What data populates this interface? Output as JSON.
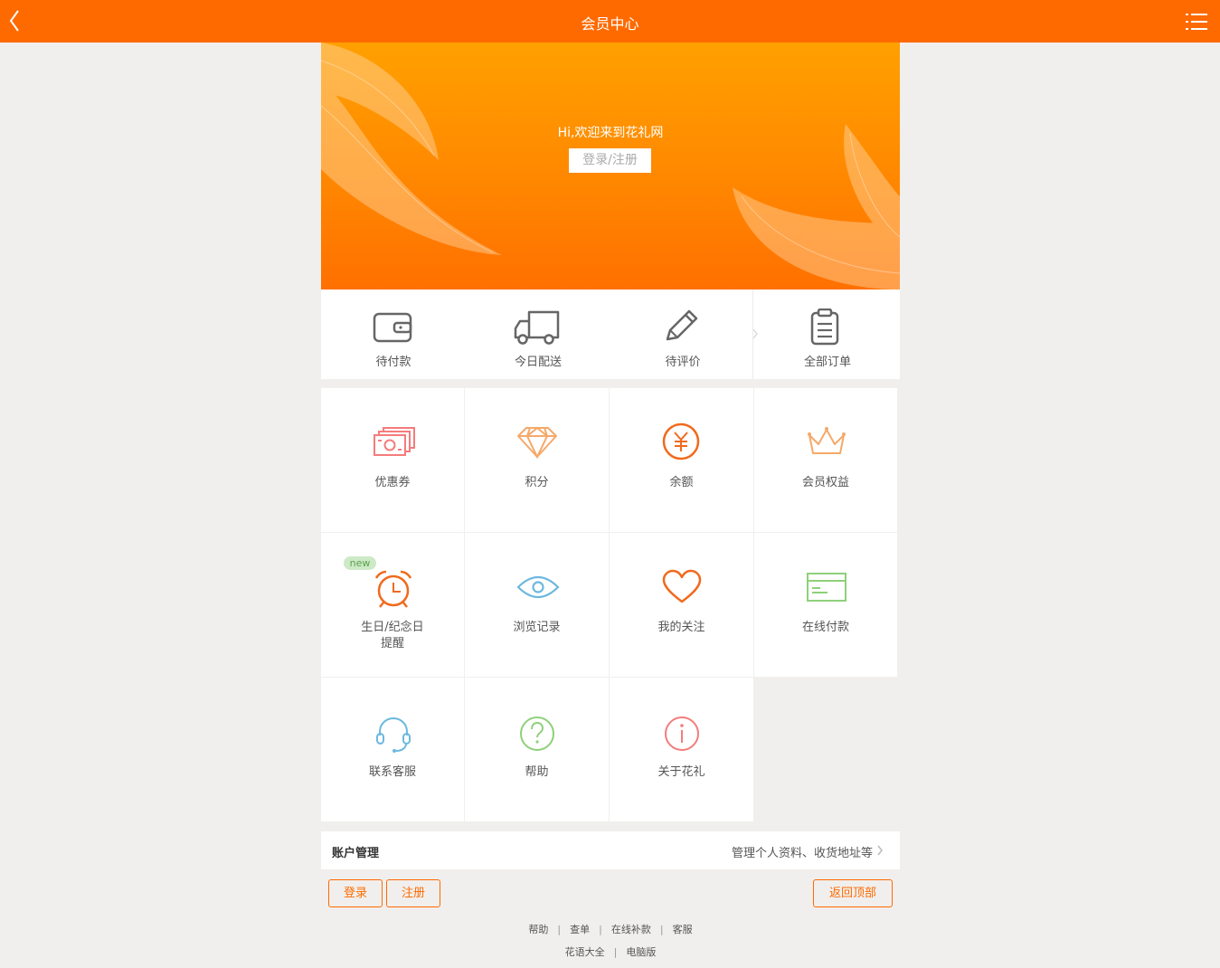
{
  "header": {
    "title": "会员中心",
    "back_icon": "chevron-left-icon",
    "menu_icon": "list-menu-icon"
  },
  "banner": {
    "welcome": "Hi,欢迎来到花礼网",
    "login_register": "登录/注册"
  },
  "orders": [
    {
      "label": "待付款",
      "icon": "wallet-icon"
    },
    {
      "label": "今日配送",
      "icon": "truck-icon"
    },
    {
      "label": "待评价",
      "icon": "pencil-icon"
    },
    {
      "label": "全部订单",
      "icon": "clipboard-icon"
    }
  ],
  "grid": [
    {
      "label": "优惠券",
      "icon": "coupon-icon",
      "color": "#f47c7c"
    },
    {
      "label": "积分",
      "icon": "diamond-icon",
      "color": "#f5a96a"
    },
    {
      "label": "余额",
      "icon": "yen-coin-icon",
      "color": "#f06a1e"
    },
    {
      "label": "会员权益",
      "icon": "crown-icon",
      "color": "#f5a96a"
    },
    {
      "label": "生日/纪念日",
      "label2": "提醒",
      "icon": "alarm-clock-icon",
      "color": "#f06a1e",
      "badge": "new"
    },
    {
      "label": "浏览记录",
      "icon": "eye-icon",
      "color": "#6cb8e0"
    },
    {
      "label": "我的关注",
      "icon": "heart-icon",
      "color": "#f06a1e"
    },
    {
      "label": "在线付款",
      "icon": "card-icon",
      "color": "#8fd07a"
    },
    {
      "label": "联系客服",
      "icon": "headset-icon",
      "color": "#6cb8e0"
    },
    {
      "label": "帮助",
      "icon": "question-icon",
      "color": "#8fd07a"
    },
    {
      "label": "关于花礼",
      "icon": "info-icon",
      "color": "#f47c7c"
    }
  ],
  "account": {
    "title": "账户管理",
    "desc": "管理个人资料、收货地址等"
  },
  "buttons": {
    "login": "登录",
    "register": "注册",
    "back_to_top": "返回顶部"
  },
  "footer": {
    "row1": [
      "帮助",
      "查单",
      "在线补款",
      "客服"
    ],
    "row2": [
      "花语大全",
      "电脑版"
    ],
    "separator": "|"
  }
}
